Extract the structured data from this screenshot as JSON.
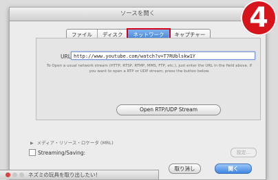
{
  "dialog": {
    "title": "ソースを開く",
    "tabs": [
      {
        "label": "ファイル"
      },
      {
        "label": "ディスク"
      },
      {
        "label": "ネットワーク"
      },
      {
        "label": "キャプチャー"
      }
    ],
    "active_tab": "ネットワーク",
    "url_label": "URL",
    "url_value": "http://www.youtube.com/watch?v=T7RUblskw1Y",
    "help_text": "To Open a usual network stream (HTTP, RTSP, RTMP, MMS, FTP, etc.), just enter the URL in the field above. If you want to open a RTP or UDP stream, press the button below.",
    "stream_button": "Open RTP/UDP Stream",
    "mrl_label": "メディア・リソース・ロケータ (MRL)",
    "streaming_label": "Streaming/Saving:",
    "settings_button": "設定...",
    "cancel_button": "取り消し",
    "open_button": "開く"
  },
  "badge": {
    "text": "4",
    "color": "#d5141c"
  },
  "bottom_window": {
    "title": "ネズミの玩具を取り出したい！"
  },
  "colors": {
    "accent": "#3f86e2",
    "highlight": "#d6001c"
  }
}
